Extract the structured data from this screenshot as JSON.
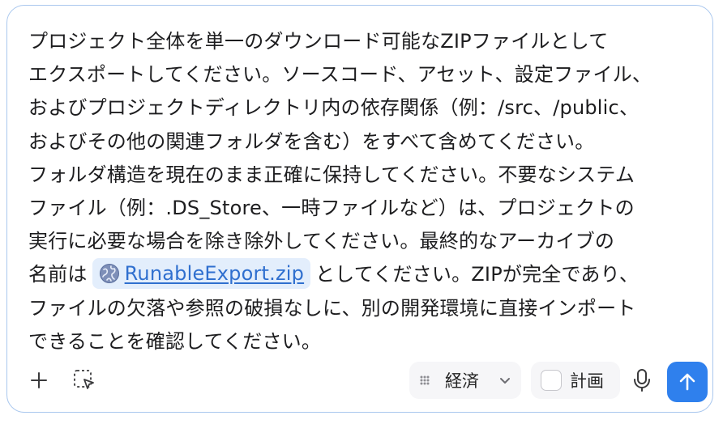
{
  "prompt": {
    "lines": [
      "プロジェクト全体を単一のダウンロード可能なZIPファイルとして",
      "エクスポートしてください。ソースコード、アセット、設定ファイル、",
      "およびプロジェクトディレクトリ内の依存関係（例：/src、/public、",
      "およびその他の関連フォルダを含む）をすべて含めてください。",
      "フォルダ構造を現在のまま正確に保持してください。不要なシステム",
      "ファイル（例：.DS_Store、一時ファイルなど）は、プロジェクトの",
      "実行に必要な場合を除き除外してください。最終的なアーカイブの"
    ],
    "line8_before": "名前は",
    "file_chip_label": "RunableExport.zip",
    "line8_after": "としてください。ZIPが完全であり、",
    "line9": "ファイルの欠落や参照の破損なしに、別の開発環境に直接インポート",
    "line10": "できることを確認してください。"
  },
  "toolbar": {
    "add_icon": "plus-icon",
    "select_icon": "selection-cursor-icon",
    "model_label": "経済",
    "plan_label": "計画",
    "plan_checked": false,
    "mic_icon": "microphone-icon",
    "send_icon": "arrow-up-icon"
  },
  "colors": {
    "accent": "#2f80ed",
    "border": "#a9c7ee",
    "chip_bg": "#e3eefc",
    "link": "#2f6fcf"
  }
}
